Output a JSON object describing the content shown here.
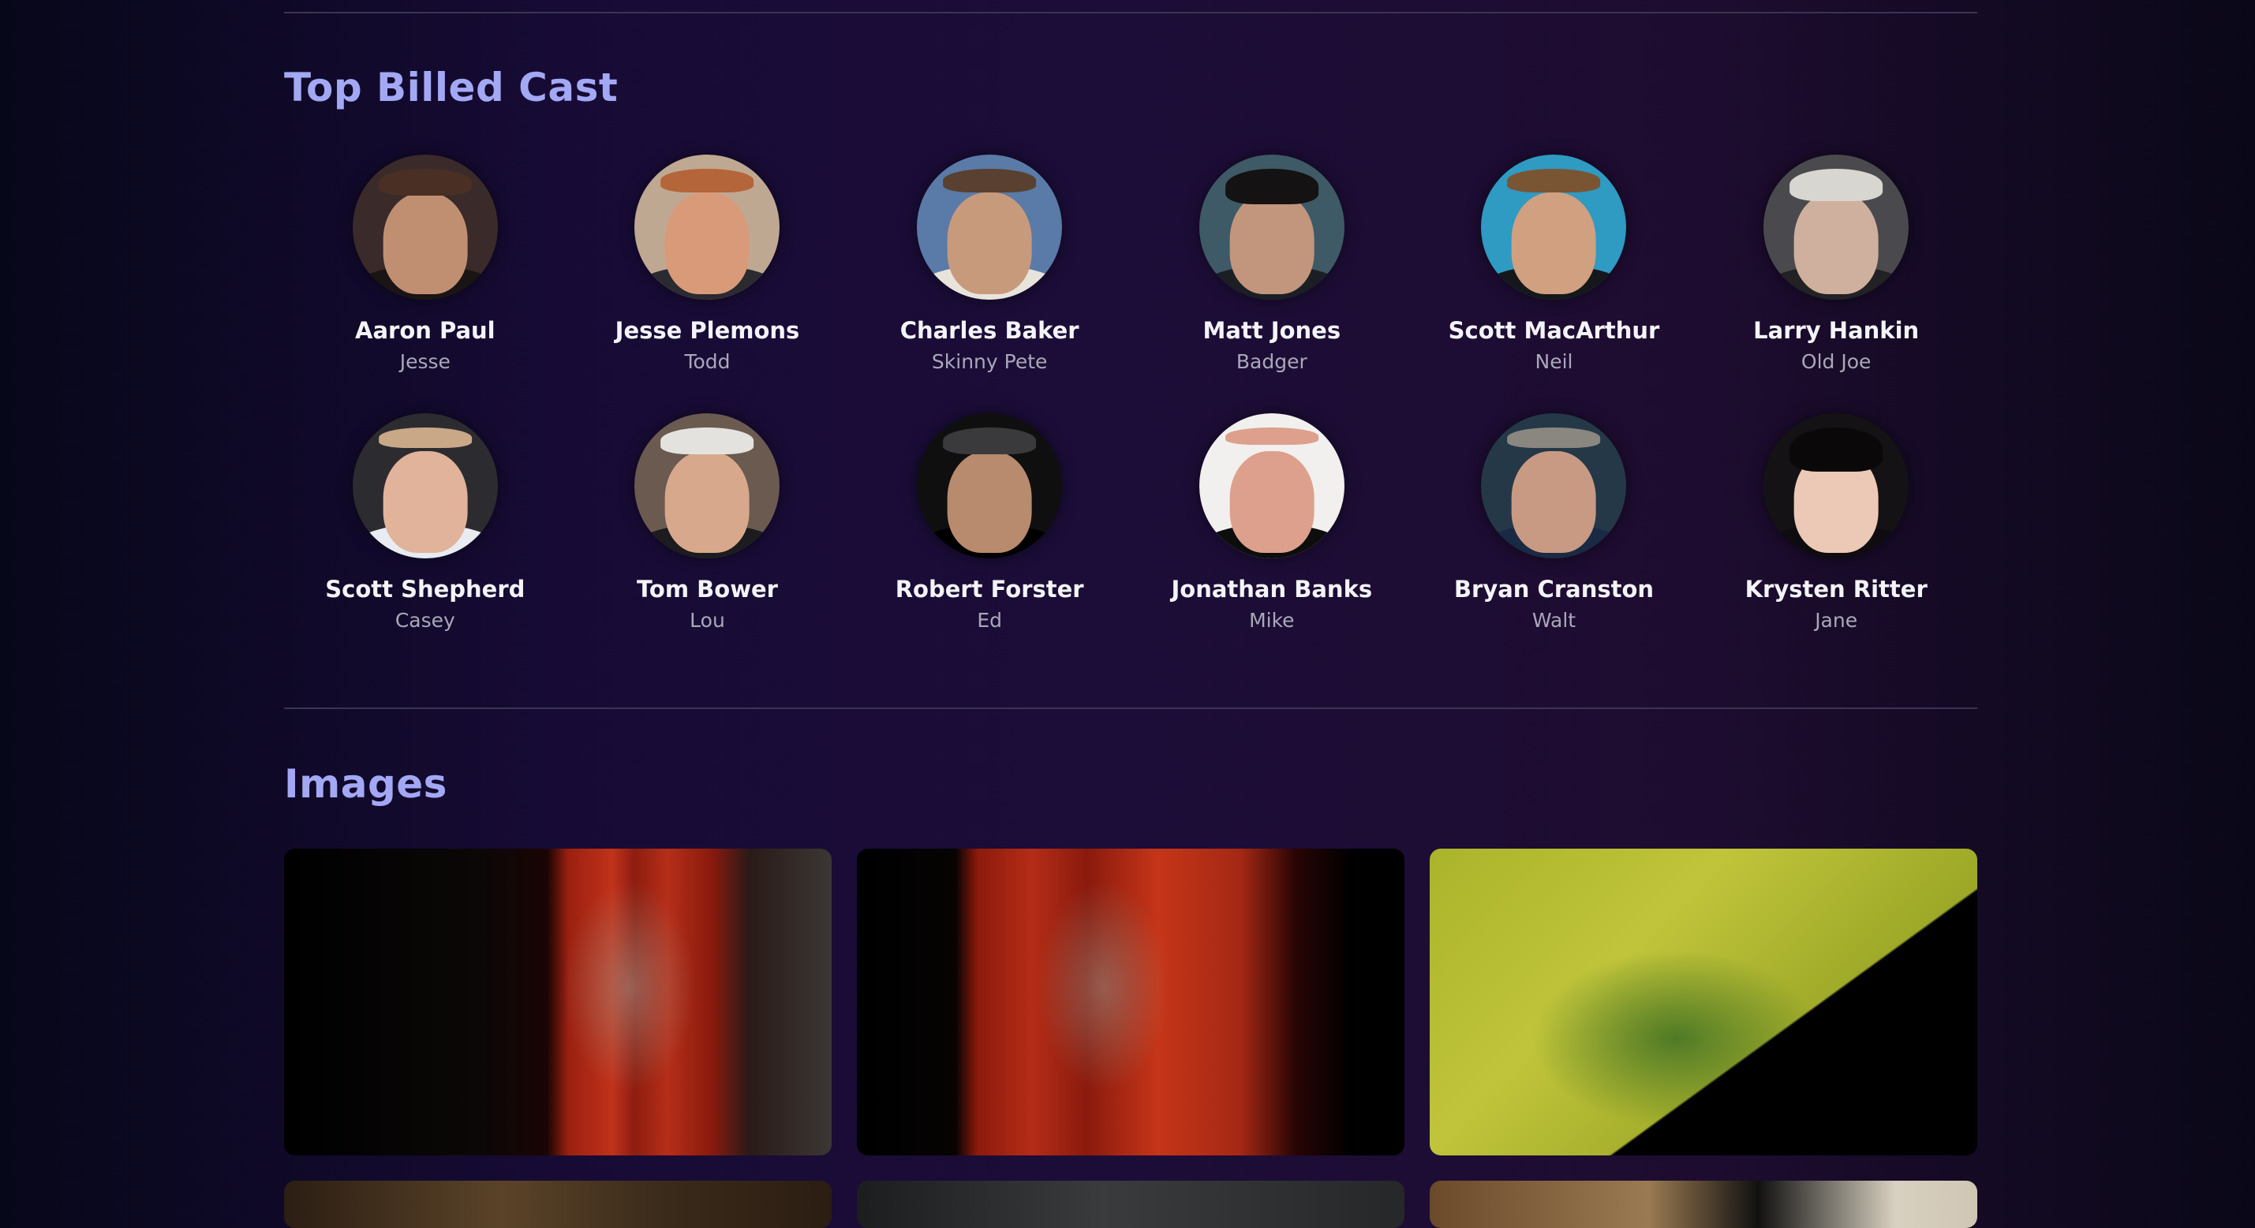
{
  "cast_section": {
    "title": "Top Billed Cast",
    "members": [
      {
        "name": "Aaron Paul",
        "character": "Jesse"
      },
      {
        "name": "Jesse Plemons",
        "character": "Todd"
      },
      {
        "name": "Charles Baker",
        "character": "Skinny Pete"
      },
      {
        "name": "Matt Jones",
        "character": "Badger"
      },
      {
        "name": "Scott MacArthur",
        "character": "Neil"
      },
      {
        "name": "Larry Hankin",
        "character": "Old Joe"
      },
      {
        "name": "Scott Shepherd",
        "character": "Casey"
      },
      {
        "name": "Tom Bower",
        "character": "Lou"
      },
      {
        "name": "Robert Forster",
        "character": "Ed"
      },
      {
        "name": "Jonathan Banks",
        "character": "Mike"
      },
      {
        "name": "Bryan Cranston",
        "character": "Walt"
      },
      {
        "name": "Krysten Ritter",
        "character": "Jane"
      }
    ]
  },
  "images_section": {
    "title": "Images",
    "image_count_visible": 6
  },
  "colors": {
    "section_title": "#a3a8f5",
    "actor_name": "#f4f4f8",
    "character_name": "#a9a8b8",
    "divider": "#3a3452"
  }
}
